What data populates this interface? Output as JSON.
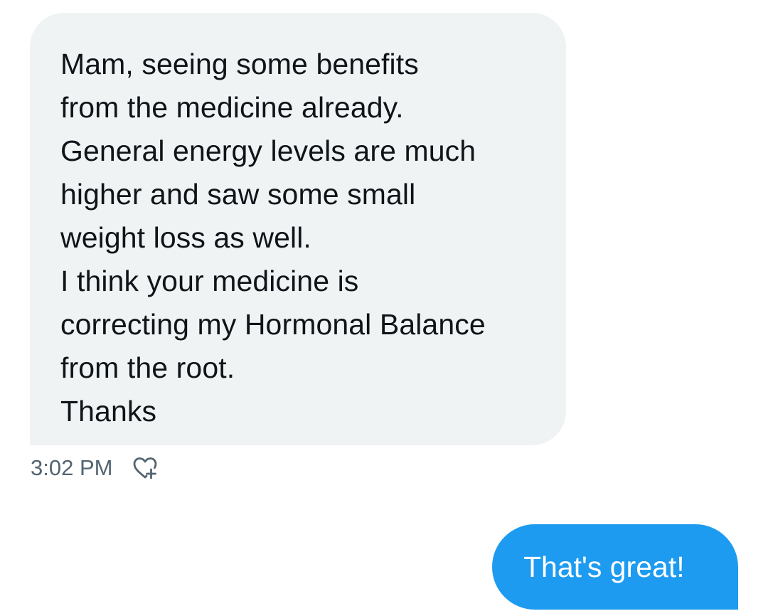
{
  "incoming": {
    "lines": [
      "Mam, seeing some benefits",
      "from the medicine already.",
      "General energy levels are much",
      "higher and saw some small",
      "weight loss as well.",
      "I think your medicine is",
      "correcting my Hormonal Balance",
      "from the root.",
      "Thanks"
    ],
    "time": "3:02 PM",
    "react_icon": "heart-plus-icon"
  },
  "outgoing": {
    "text": "That's great!"
  },
  "colors": {
    "incoming_bubble": "#eff3f4",
    "outgoing_bubble": "#1d9bf0",
    "text": "#0f1419",
    "meta": "#536471"
  }
}
